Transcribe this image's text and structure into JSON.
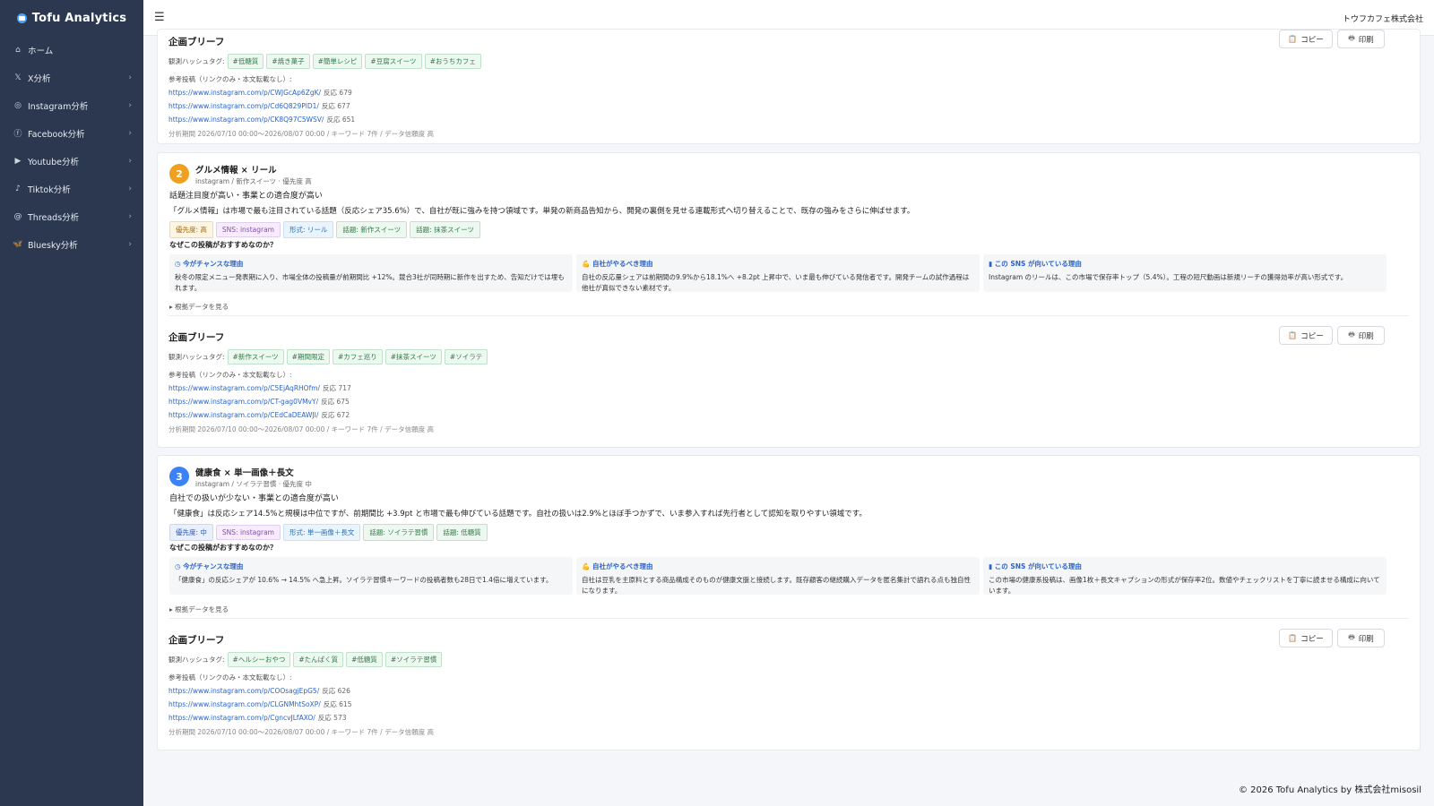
{
  "brand": {
    "name": "Tofu Analytics"
  },
  "sidebar": {
    "items": [
      {
        "icon": "home-icon",
        "glyph": "⌂",
        "label": "ホーム",
        "chevron": ""
      },
      {
        "icon": "x-icon",
        "glyph": "𝕏",
        "label": "X分析",
        "chevron": "›"
      },
      {
        "icon": "instagram-icon",
        "glyph": "◎",
        "label": "Instagram分析",
        "chevron": "›"
      },
      {
        "icon": "facebook-icon",
        "glyph": "ⓕ",
        "label": "Facebook分析",
        "chevron": "›"
      },
      {
        "icon": "youtube-icon",
        "glyph": "▶",
        "label": "Youtube分析",
        "chevron": "›"
      },
      {
        "icon": "tiktok-icon",
        "glyph": "♪",
        "label": "Tiktok分析",
        "chevron": "›"
      },
      {
        "icon": "threads-icon",
        "glyph": "@",
        "label": "Threads分析",
        "chevron": "›"
      },
      {
        "icon": "bluesky-icon",
        "glyph": "🦋",
        "label": "Bluesky分析",
        "chevron": "›"
      }
    ]
  },
  "header": {
    "menu_icon": "hamburger-icon",
    "company": "トウフカフェ株式会社"
  },
  "common": {
    "brief_title": "企画ブリーフ",
    "copy_label": "コピー",
    "print_label": "印刷",
    "hashtag_label": "観測ハッシュタグ:",
    "refs_label": "参考投稿（リンクのみ・本文転載なし）:",
    "why_label": "なぜこの投稿がおすすめなのか？",
    "toggle_label": "根拠データを見る",
    "reason_heads": [
      "今がチャンスな理由",
      "自社がやるべき理由",
      "この SNS が向いている理由"
    ]
  },
  "briefs": [
    {
      "hashtags": [
        "#低糖質",
        "#焼き菓子",
        "#簡単レシピ",
        "#豆腐スイーツ",
        "#おうちカフェ"
      ],
      "links": [
        {
          "url": "https://www.instagram.com/p/CWJGcAp6ZgK/",
          "reaction": "反応 679"
        },
        {
          "url": "https://www.instagram.com/p/Cd6Q829PlD1/",
          "reaction": "反応 677"
        },
        {
          "url": "https://www.instagram.com/p/CK8Q97C5WSV/",
          "reaction": "反応 651"
        }
      ],
      "meta": "分析期間 2026/07/10 00:00〜2026/08/07 00:00 / キーワード 7件 / データ信頼度 高"
    },
    {
      "hashtags": [
        "#新作スイーツ",
        "#期間限定",
        "#カフェ巡り",
        "#抹茶スイーツ",
        "#ソイラテ"
      ],
      "links": [
        {
          "url": "https://www.instagram.com/p/C5EjAqRHOfm/",
          "reaction": "反応 717"
        },
        {
          "url": "https://www.instagram.com/p/CT-gag0VMvY/",
          "reaction": "反応 675"
        },
        {
          "url": "https://www.instagram.com/p/CEdCaDEAWJI/",
          "reaction": "反応 672"
        }
      ],
      "meta": "分析期間 2026/07/10 00:00〜2026/08/07 00:00 / キーワード 7件 / データ信頼度 高"
    },
    {
      "hashtags": [
        "#ヘルシーおやつ",
        "#たんぱく質",
        "#低糖質",
        "#ソイラテ習慣"
      ],
      "links": [
        {
          "url": "https://www.instagram.com/p/COOsagjEpG5/",
          "reaction": "反応 626"
        },
        {
          "url": "https://www.instagram.com/p/CLGNMhtSoXP/",
          "reaction": "反応 615"
        },
        {
          "url": "https://www.instagram.com/p/CgncvJLfAXO/",
          "reaction": "反応 573"
        }
      ],
      "meta": "分析期間 2026/07/10 00:00〜2026/08/07 00:00 / キーワード 7件 / データ信頼度 高"
    }
  ],
  "proposals": [
    {
      "number": "2",
      "color": "#f0a020",
      "title": "グルメ情報 × リール",
      "sub": "instagram / 新作スイーツ · 優先度 高",
      "lead": "話題注目度が高い・事業との適合度が高い",
      "desc": "「グルメ情報」は市場で最も注目されている話題（反応シェア35.6%）で、自社が既に強みを持つ領域です。単発の新商品告知から、開発の裏側を見せる連載形式へ切り替えることで、既存の強みをさらに伸ばせます。",
      "chips": [
        "優先度: 高",
        "SNS: instagram",
        "形式: リール",
        "話題: 新作スイーツ",
        "話題: 抹茶スイーツ"
      ],
      "reasons": [
        "秋冬の限定メニュー発表期に入り、市場全体の投稿量が前期間比 +12%。競合3社が同時期に新作を出すため、告知だけでは埋もれます。",
        "自社の反応量シェアは前期間の9.9%から18.1%へ +8.2pt 上昇中で、いま最も伸びている発信者です。開発チームの試作過程は他社が真似できない素材です。",
        "Instagram のリールは、この市場で保存率トップ（5.4%）。工程の短尺動画は新規リーチの獲得効率が高い形式です。"
      ]
    },
    {
      "number": "3",
      "color": "#3b82f6",
      "title": "健康食 × 単一画像＋長文",
      "sub": "instagram / ソイラテ習慣 · 優先度 中",
      "lead": "自社での扱いが少ない・事業との適合度が高い",
      "desc": "「健康食」は反応シェア14.5%と規模は中位ですが、前期間比 +3.9pt と市場で最も伸びている話題です。自社の扱いは2.9%とほぼ手つかずで、いま参入すれば先行者として認知を取りやすい領域です。",
      "chips": [
        "優先度: 中",
        "SNS: instagram",
        "形式: 単一画像＋長文",
        "話題: ソイラテ習慣",
        "話題: 低糖質"
      ],
      "reasons": [
        "「健康食」の反応シェアが 10.6% → 14.5% へ急上昇。ソイラテ習慣キーワードの投稿者数も28日で1.4倍に増えています。",
        "自社は豆乳を主原料とする商品構成そのものが健康文脈と接続します。既存顧客の継続購入データを匿名集計で語れる点も独自性になります。",
        "この市場の健康系投稿は、画像1枚＋長文キャプションの形式が保存率2位。数値やチェックリストを丁寧に読ませる構成に向いています。"
      ]
    }
  ],
  "footer": {
    "text": "© 2026 Tofu Analytics by 株式会社misosil"
  }
}
